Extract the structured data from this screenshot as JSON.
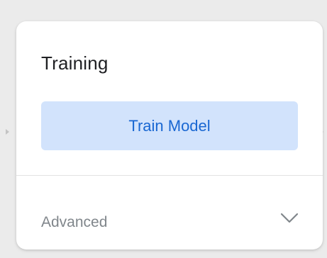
{
  "card": {
    "title": "Training",
    "train_button_label": "Train Model",
    "advanced_label": "Advanced"
  },
  "icons": {
    "advanced_toggle": "chevron-down-icon",
    "edge_left": "arrow-right-icon",
    "edge_right": "arrow-right-icon"
  },
  "colors": {
    "button_bg": "#d2e3fc",
    "button_text": "#1967d2",
    "title_text": "#202124",
    "muted_text": "#80868b",
    "background": "#ebebeb"
  }
}
